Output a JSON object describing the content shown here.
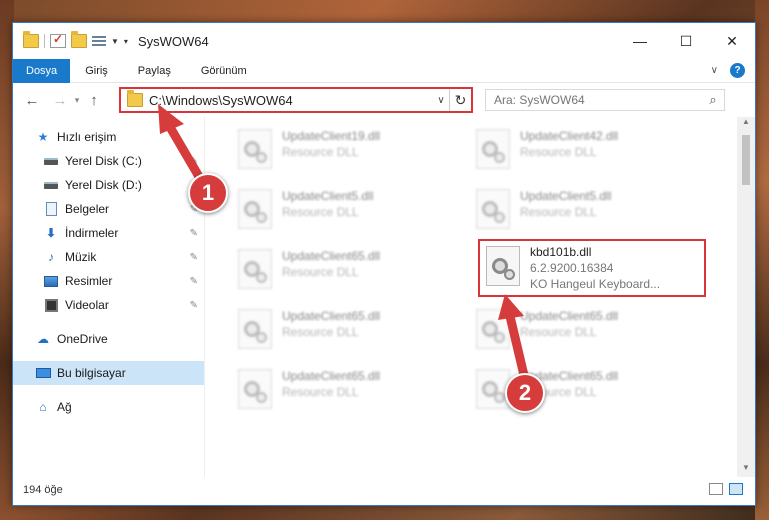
{
  "window": {
    "title": "SysWOW64"
  },
  "ribbon": {
    "tabs": [
      "Dosya",
      "Giriş",
      "Paylaş",
      "Görünüm"
    ]
  },
  "address": {
    "path": "C:\\Windows\\SysWOW64"
  },
  "search": {
    "placeholder": "Ara: SysWOW64"
  },
  "nav": {
    "quick_access": "Hızlı erişim",
    "items": [
      {
        "label": "Yerel Disk (C:)",
        "icon": "drive-icon",
        "pinned": true
      },
      {
        "label": "Yerel Disk (D:)",
        "icon": "drive-icon",
        "pinned": false
      },
      {
        "label": "Belgeler",
        "icon": "documents-icon",
        "pinned": true
      },
      {
        "label": "İndirmeler",
        "icon": "downloads-icon",
        "pinned": true
      },
      {
        "label": "Müzik",
        "icon": "music-icon",
        "pinned": true
      },
      {
        "label": "Resimler",
        "icon": "pictures-icon",
        "pinned": true
      },
      {
        "label": "Videolar",
        "icon": "videos-icon",
        "pinned": true
      }
    ],
    "onedrive": "OneDrive",
    "this_pc": "Bu bilgisayar",
    "network": "Ağ"
  },
  "files": {
    "left": [
      {
        "name": "UpdateClient19.dll",
        "sub": "Resource DLL"
      },
      {
        "name": "UpdateClient5.dll",
        "sub": "Resource DLL"
      },
      {
        "name": "UpdateClient65.dll",
        "sub": "Resource DLL"
      },
      {
        "name": "UpdateClient65.dll",
        "sub": "Resource DLL"
      },
      {
        "name": "UpdateClient65.dll",
        "sub": "Resource DLL"
      }
    ],
    "right": [
      {
        "name": "UpdateClient42.dll",
        "sub": "Resource DLL"
      },
      {
        "name": "UpdateClient5.dll",
        "sub": "Resource DLL"
      },
      {
        "name": "kbd101b.dll",
        "sub": "6.2.9200.16384",
        "sub2": "KO Hangeul Keyboard..."
      },
      {
        "name": "UpdateClient65.dll",
        "sub": "Resource DLL"
      },
      {
        "name": "UpdateClient65.dll",
        "sub": "Resource DLL"
      }
    ]
  },
  "status": {
    "count": "194 öğe"
  },
  "annotations": {
    "step1": "1",
    "step2": "2",
    "color": "#d63c3c"
  }
}
